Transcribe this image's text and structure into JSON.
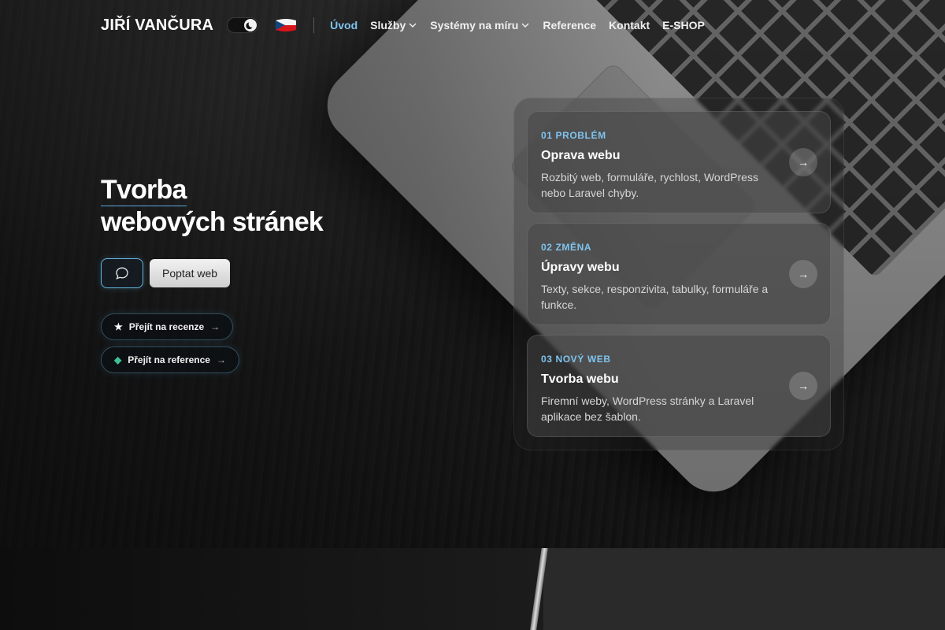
{
  "header": {
    "brand": "JIŘÍ VANČURA",
    "nav": {
      "home": "Úvod",
      "services": "Služby",
      "systems": "Systémy na míru",
      "references": "Reference",
      "contact": "Kontakt",
      "eshop": "E-SHOP"
    },
    "theme_icon": "moon-icon",
    "language_icon": "czech-flag-icon"
  },
  "hero": {
    "title_line1": "Tvorba",
    "title_line2": "webových stránek",
    "chat_icon": "chat-bubble-icon",
    "quote_button": "Poptat web",
    "reviews_link": {
      "symbol": "★",
      "label": "Přejít na recenze",
      "arrow": "→"
    },
    "references_link": {
      "symbol": "◆",
      "label": "Přejít na reference",
      "arrow": "→"
    }
  },
  "services": [
    {
      "kicker": "01 PROBLÉM",
      "title": "Oprava webu",
      "description": "Rozbitý web, formuláře, rychlost, WordPress nebo Laravel chyby.",
      "arrow": "→"
    },
    {
      "kicker": "02 ZMĚNA",
      "title": "Úpravy webu",
      "description": "Texty, sekce, responzivita, tabulky, formuláře a funkce.",
      "arrow": "→"
    },
    {
      "kicker": "03 NOVÝ WEB",
      "title": "Tvorba webu",
      "description": "Firemní weby, WordPress stránky a Laravel aplikace bez šablon.",
      "arrow": "→"
    }
  ],
  "colors": {
    "accent": "#7fc4ef",
    "reviews_symbol": "#ffffff",
    "references_symbol": "#3fbf8f"
  }
}
